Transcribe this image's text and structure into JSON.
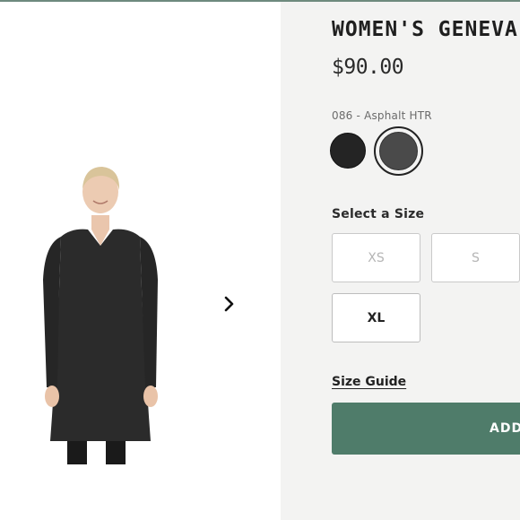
{
  "product": {
    "title": "WOMEN'S GENEVA DRESS",
    "price": "$90.00",
    "selected_color": "086 - Asphalt HTR"
  },
  "swatches": [
    {
      "name": "black-swatch",
      "color": "#242424"
    },
    {
      "name": "asphalt-swatch",
      "color": "#4a4a4a",
      "selected": true
    }
  ],
  "size": {
    "label": "Select a Size",
    "options": [
      {
        "label": "XS",
        "available": false
      },
      {
        "label": "S",
        "available": false
      },
      {
        "label": "XL",
        "available": true
      }
    ]
  },
  "links": {
    "size_guide": "Size Guide"
  },
  "actions": {
    "add_to_cart": "ADD T"
  },
  "gallery": {
    "next_icon": "chevron-right-icon"
  },
  "colors": {
    "accent": "#4f7c6a",
    "panel_bg": "#f3f3f2"
  }
}
